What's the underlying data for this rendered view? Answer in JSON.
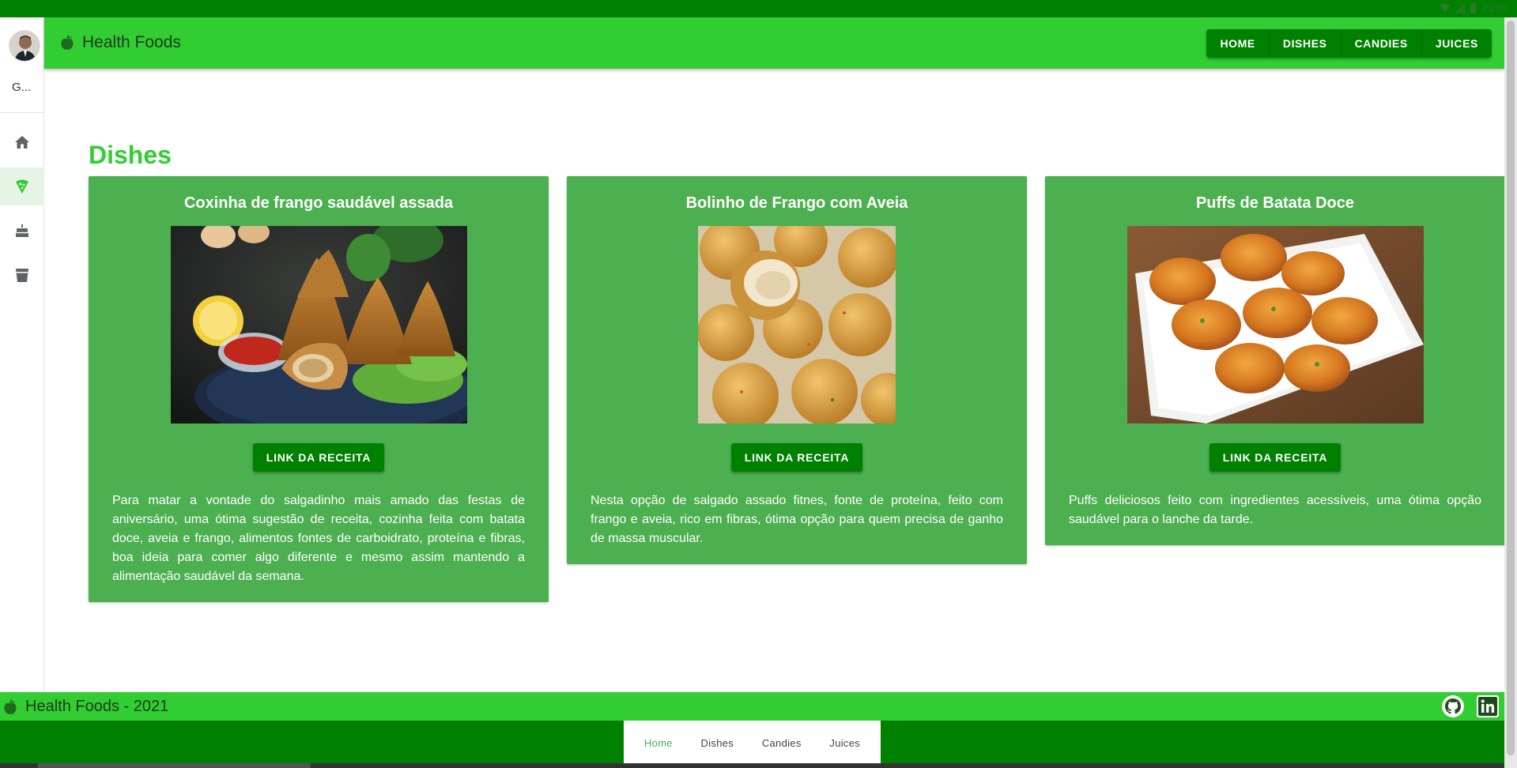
{
  "statusbar": {
    "time": "23:59"
  },
  "rail": {
    "user_short": "G...",
    "items": [
      {
        "icon": "home-icon",
        "active": false
      },
      {
        "icon": "pizza-icon",
        "active": true
      },
      {
        "icon": "cake-icon",
        "active": false
      },
      {
        "icon": "cup-icon",
        "active": false
      }
    ]
  },
  "appbar": {
    "title": "Health Foods",
    "nav": [
      "HOME",
      "DISHES",
      "CANDIES",
      "JUICES"
    ]
  },
  "main": {
    "title": "Dishes",
    "cards": [
      {
        "title": "Coxinha de frango saudável assada",
        "button": "LINK DA RECEITA",
        "description": "Para matar a vontade do salgadinho mais amado das festas de aniversário, uma ótima sugestão de receita, cozinha feita com batata doce, aveia e frango, alimentos fontes de carboidrato, proteína e fibras, boa ideia para comer algo diferente e mesmo assim mantendo a alimentação saudável da semana."
      },
      {
        "title": "Bolinho de Frango com Aveia",
        "button": "LINK DA RECEITA",
        "description": "Nesta opção de salgado assado fitnes, fonte de proteína, feito com frango e aveia, rico em fibras, ótima opção para quem precisa de ganho de massa muscular."
      },
      {
        "title": "Puffs de Batata Doce",
        "button": "LINK DA RECEITA",
        "description": "Puffs deliciosos feito com ingredientes acessíveis, uma ótima opção saudável para o lanche da tarde."
      }
    ]
  },
  "footer": {
    "title": "Health Foods - 2021"
  },
  "bottom_nav": {
    "items": [
      "Home",
      "Dishes",
      "Candies",
      "Juices"
    ],
    "active": "Home"
  },
  "colors": {
    "primary": "#32cd32",
    "dark": "#008000",
    "card": "#4caf50"
  }
}
